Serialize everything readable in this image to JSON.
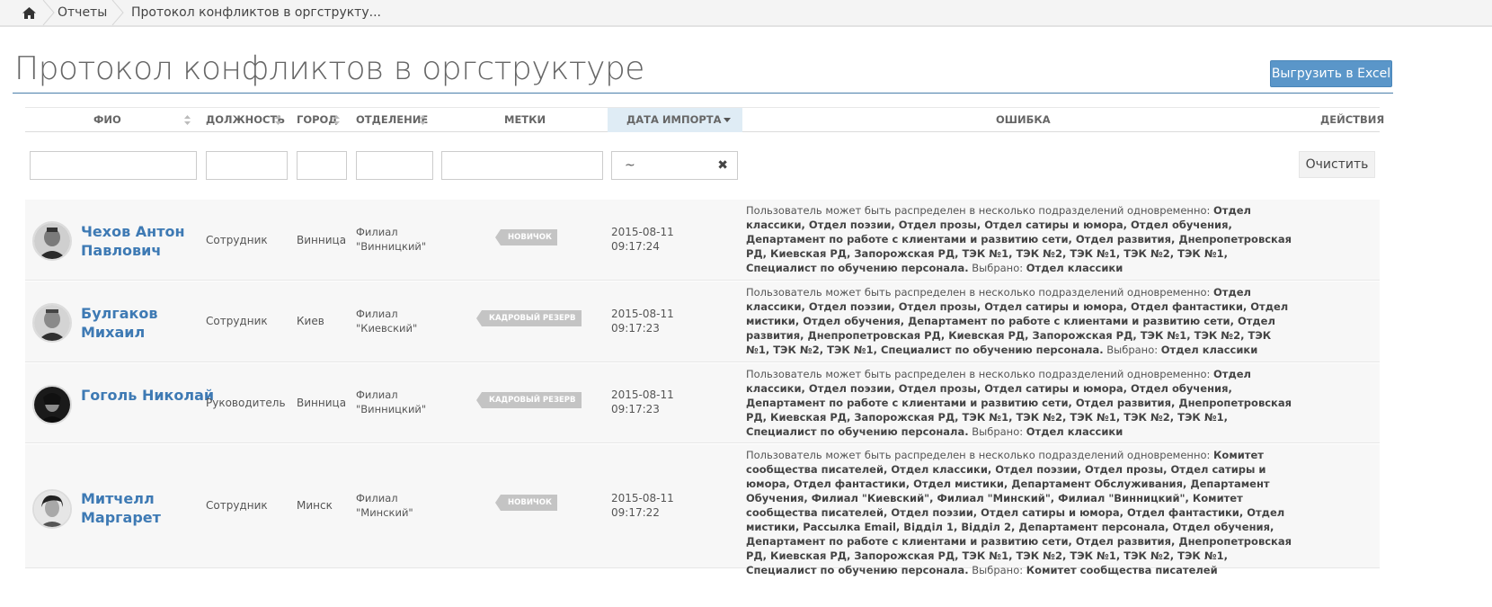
{
  "breadcrumb": {
    "items": [
      "Отчеты",
      "Протокол конфликтов в оргструкту..."
    ]
  },
  "page": {
    "title": "Протокол конфликтов в оргструктуре",
    "export_label": "Выгрузить в Excel",
    "accent": "#5a96c9"
  },
  "table": {
    "headers": {
      "fio": "ФИО",
      "position": "ДОЛЖНОСТЬ",
      "city": "ГОРОД",
      "department": "ОТДЕЛЕНИЕ",
      "tags": "МЕТКИ",
      "import_date": "ДАТА ИМПОРТА",
      "error": "ОШИБКА",
      "actions": "ДЕЙСТВИЯ"
    },
    "filters": {
      "date_value": "~",
      "clear_label": "Очистить"
    },
    "rows": [
      {
        "name": "Чехов Антон Павлович",
        "position": "Сотрудник",
        "city": "Винница",
        "dept_line1": "Филиал",
        "dept_line2": "\"Винницкий\"",
        "tag": "НОВИЧОК",
        "date": "2015-08-11",
        "time": "09:17:24",
        "err_prefix": "Пользователь может быть распределен в несколько подразделений одновременно: ",
        "err_list": "Отдел классики, Отдел поэзии, Отдел прозы, Отдел сатиры и юмора, Отдел обучения, Департамент по работе с клиентами и развитию сети, Отдел развития, Днепропетровская РД, Киевская РД, Запорожская РД, ТЭК №1, ТЭК №2, ТЭК №1, ТЭК №2, ТЭК №1, Специалист по обучению персонала.",
        "err_selected_label": " Выбрано: ",
        "err_selected": "Отдел классики"
      },
      {
        "name": "Булгаков Михаил",
        "position": "Сотрудник",
        "city": "Киев",
        "dept_line1": "Филиал",
        "dept_line2": "\"Киевский\"",
        "tag": "КАДРОВЫЙ РЕЗЕРВ",
        "date": "2015-08-11",
        "time": "09:17:23",
        "err_prefix": "Пользователь может быть распределен в несколько подразделений одновременно: ",
        "err_list": "Отдел классики, Отдел поэзии, Отдел прозы, Отдел сатиры и юмора, Отдел фантастики, Отдел мистики, Отдел обучения, Департамент по работе с клиентами и развитию сети, Отдел развития, Днепропетровская РД, Киевская РД, Запорожская РД, ТЭК №1, ТЭК №2, ТЭК №1, ТЭК №2, ТЭК №1, Специалист по обучению персонала.",
        "err_selected_label": " Выбрано: ",
        "err_selected": "Отдел классики"
      },
      {
        "name": "Гоголь Николай",
        "position": "Руководитель",
        "city": "Винница",
        "dept_line1": "Филиал",
        "dept_line2": "\"Винницкий\"",
        "tag": "КАДРОВЫЙ РЕЗЕРВ",
        "date": "2015-08-11",
        "time": "09:17:23",
        "err_prefix": "Пользователь может быть распределен в несколько подразделений одновременно: ",
        "err_list": "Отдел классики, Отдел поэзии, Отдел прозы, Отдел сатиры и юмора, Отдел обучения, Департамент по работе с клиентами и развитию сети, Отдел развития, Днепропетровская РД, Киевская РД, Запорожская РД, ТЭК №1, ТЭК №2, ТЭК №1, ТЭК №2, ТЭК №1, Специалист по обучению персонала.",
        "err_selected_label": " Выбрано: ",
        "err_selected": "Отдел классики"
      },
      {
        "name": "Митчелл Маргарет",
        "position": "Сотрудник",
        "city": "Минск",
        "dept_line1": "Филиал",
        "dept_line2": "\"Минский\"",
        "tag": "НОВИЧОК",
        "date": "2015-08-11",
        "time": "09:17:22",
        "err_prefix": "Пользователь может быть распределен в несколько подразделений одновременно: ",
        "err_list": "Комитет сообщества писателей, Отдел классики, Отдел поэзии, Отдел прозы, Отдел сатиры и юмора, Отдел фантастики, Отдел мистики, Департамент Обслуживания, Департамент Обучения, Филиал \"Киевский\", Филиал \"Минский\", Филиал \"Винницкий\", Комитет сообщества писателей, Отдел поэзии, Отдел сатиры и юмора, Отдел фантастики, Отдел мистики, Рассылка Email, Відділ 1, Відділ 2, Департамент персонала, Отдел обучения, Департамент по работе с клиентами и развитию сети, Отдел развития, Днепропетровская РД, Киевская РД, Запорожская РД, ТЭК №1, ТЭК №2, ТЭК №1, ТЭК №2, ТЭК №1, Специалист по обучению персонала.",
        "err_selected_label": " Выбрано: ",
        "err_selected": "Комитет сообщества писателей"
      }
    ]
  }
}
